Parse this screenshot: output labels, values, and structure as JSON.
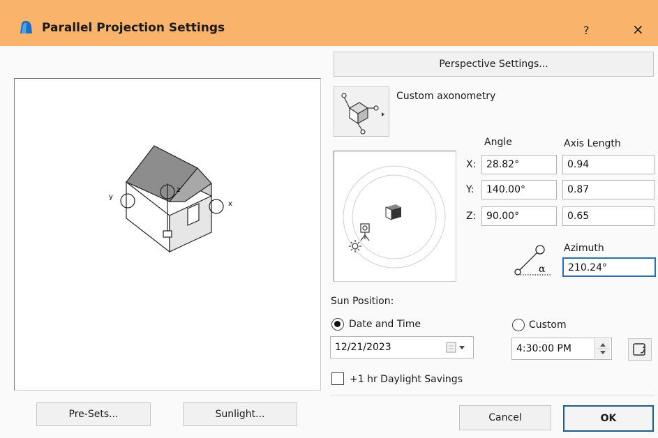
{
  "window": {
    "title": "Parallel Projection Settings",
    "help": "?",
    "close": "×",
    "app_icon": "archicad-app-icon",
    "titlebar_color": "#f9b36b"
  },
  "preview": {
    "axis_labels": {
      "y": "y",
      "z": "z",
      "x": "x"
    }
  },
  "perspective_button": "Perspective Settings...",
  "axonometry": {
    "label": "Custom axonometry",
    "icon": "axonometry-icon"
  },
  "axes": {
    "angle_header": "Angle",
    "length_header": "Axis Length",
    "rows": [
      {
        "label": "X:",
        "angle": "28.82°",
        "length": "0.94"
      },
      {
        "label": "Y:",
        "angle": "140.00°",
        "length": "0.87"
      },
      {
        "label": "Z:",
        "angle": "90.00°",
        "length": "0.65"
      }
    ]
  },
  "azimuth": {
    "label": "Azimuth",
    "value": "210.24°",
    "icon_symbol": "α"
  },
  "sun": {
    "heading": "Sun Position:",
    "date_time_label": "Date and Time",
    "date_time_selected": true,
    "custom_label": "Custom",
    "custom_selected": false,
    "date": "12/21/2023",
    "time": "4:30:00 PM",
    "daylight_label": "+1 hr Daylight Savings",
    "daylight_checked": false
  },
  "buttons": {
    "presets": "Pre-Sets...",
    "sunlight": "Sunlight...",
    "cancel": "Cancel",
    "ok": "OK"
  },
  "colors": {
    "accent_focus": "#2a6eb0",
    "ok_border": "#1f5d86"
  }
}
